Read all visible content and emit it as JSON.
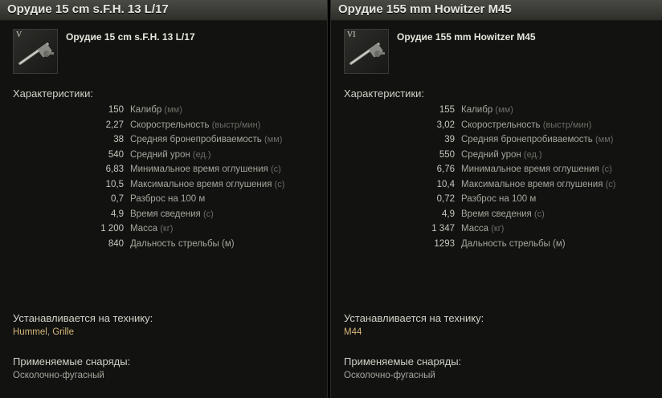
{
  "panels": [
    {
      "title": "Орудие 15 cm s.F.H. 13 L/17",
      "tier": "V",
      "module_name": "Орудие 15 cm s.F.H. 13 L/17",
      "characteristics_heading": "Характеристики:",
      "stats": [
        {
          "value": "150",
          "label": "Калибр",
          "unit": "(мм)"
        },
        {
          "value": "2,27",
          "label": "Скорострельность",
          "unit": "(выстр/мин)"
        },
        {
          "value": "38",
          "label": "Средняя бронепробиваемость",
          "unit": "(мм)"
        },
        {
          "value": "540",
          "label": "Средний урон",
          "unit": "(ед.)"
        },
        {
          "value": "6,83",
          "label": "Минимальное время оглушения",
          "unit": "(с)"
        },
        {
          "value": "10,5",
          "label": "Максимальное время оглушения",
          "unit": "(с)"
        },
        {
          "value": "0,7",
          "label": "Разброс на 100 м",
          "unit": ""
        },
        {
          "value": "4,9",
          "label": "Время сведения",
          "unit": "(с)"
        },
        {
          "value": "1 200",
          "label": "Масса",
          "unit": "(кг)"
        },
        {
          "value": "840",
          "label": "Дальность стрельбы (м)",
          "unit": ""
        }
      ],
      "installed_heading": "Устанавливается на технику:",
      "vehicles": [
        "Hummel",
        "Grille"
      ],
      "shells_heading": "Применяемые снаряды:",
      "shells": "Осколочно-фугасный"
    },
    {
      "title": "Орудие 155 mm Howitzer M45",
      "tier": "VI",
      "module_name": "Орудие 155 mm Howitzer M45",
      "characteristics_heading": "Характеристики:",
      "stats": [
        {
          "value": "155",
          "label": "Калибр",
          "unit": "(мм)"
        },
        {
          "value": "3,02",
          "label": "Скорострельность",
          "unit": "(выстр/мин)"
        },
        {
          "value": "39",
          "label": "Средняя бронепробиваемость",
          "unit": "(мм)"
        },
        {
          "value": "550",
          "label": "Средний урон",
          "unit": "(ед.)"
        },
        {
          "value": "6,76",
          "label": "Минимальное время оглушения",
          "unit": "(с)"
        },
        {
          "value": "10,4",
          "label": "Максимальное время оглушения",
          "unit": "(с)"
        },
        {
          "value": "0,72",
          "label": "Разброс на 100 м",
          "unit": ""
        },
        {
          "value": "4,9",
          "label": "Время сведения",
          "unit": "(с)"
        },
        {
          "value": "1 347",
          "label": "Масса",
          "unit": "(кг)"
        },
        {
          "value": "1293",
          "label": "Дальность стрельбы (м)",
          "unit": ""
        }
      ],
      "installed_heading": "Устанавливается на технику:",
      "vehicles": [
        "M44"
      ],
      "shells_heading": "Применяемые снаряды:",
      "shells": "Осколочно-фугасный"
    }
  ],
  "icons": {
    "module": "artillery-gun-icon"
  },
  "colors": {
    "vehicle_link": "#d4b57a",
    "background": "#121210",
    "unit_text": "#6c6c66"
  }
}
